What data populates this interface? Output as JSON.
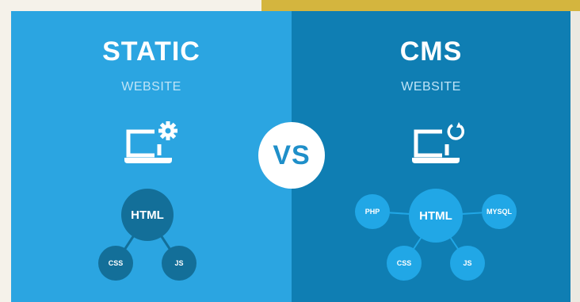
{
  "left": {
    "title": "STATIC",
    "subtitle": "WEBSITE",
    "icon": "laptop-gear-icon",
    "diagram": {
      "center": "HTML",
      "children": [
        "CSS",
        "JS"
      ]
    }
  },
  "right": {
    "title": "CMS",
    "subtitle": "WEBSITE",
    "icon": "laptop-refresh-icon",
    "diagram": {
      "center": "HTML",
      "children": [
        "PHP",
        "MYSQL",
        "CSS",
        "JS"
      ]
    }
  },
  "vs_label": "VS",
  "colors": {
    "left_panel": "#2ba5e1",
    "right_panel": "#0f7eb3",
    "accent_bar": "#d4b53e",
    "background": "#f5f2ea"
  }
}
